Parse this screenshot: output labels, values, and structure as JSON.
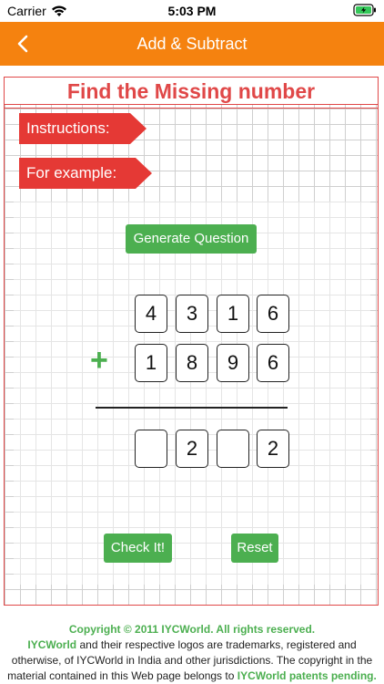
{
  "status_bar": {
    "carrier": "Carrier",
    "time": "5:03 PM",
    "icons": [
      "wifi-icon",
      "battery-charging-icon"
    ]
  },
  "nav": {
    "title": "Add & Subtract",
    "back_icon": "chevron-left-icon",
    "background_color": "#f5820f"
  },
  "worksheet": {
    "title": "Find the Missing number",
    "instructions_label": "Instructions:",
    "example_label": "For example:",
    "generate_label": "Generate Question",
    "operator": "+",
    "row1": [
      "4",
      "3",
      "1",
      "6"
    ],
    "row2": [
      "1",
      "8",
      "9",
      "6"
    ],
    "answer": [
      "",
      "2",
      "",
      "2"
    ],
    "check_label": "Check It!",
    "reset_label": "Reset",
    "accent_red": "#e53935",
    "accent_green": "#4caf50"
  },
  "footer": {
    "copyright": "Copyright © 2011 IYCWorld. All rights reserved.",
    "brand1": "IYCWorld",
    "text1": " and their respective logos are trademarks, registered and otherwise, of  IYCWorld in India and other jurisdictions. The copyright in the material contained in this Web page belongs to ",
    "brand2": "IYCWorld patents pending."
  }
}
